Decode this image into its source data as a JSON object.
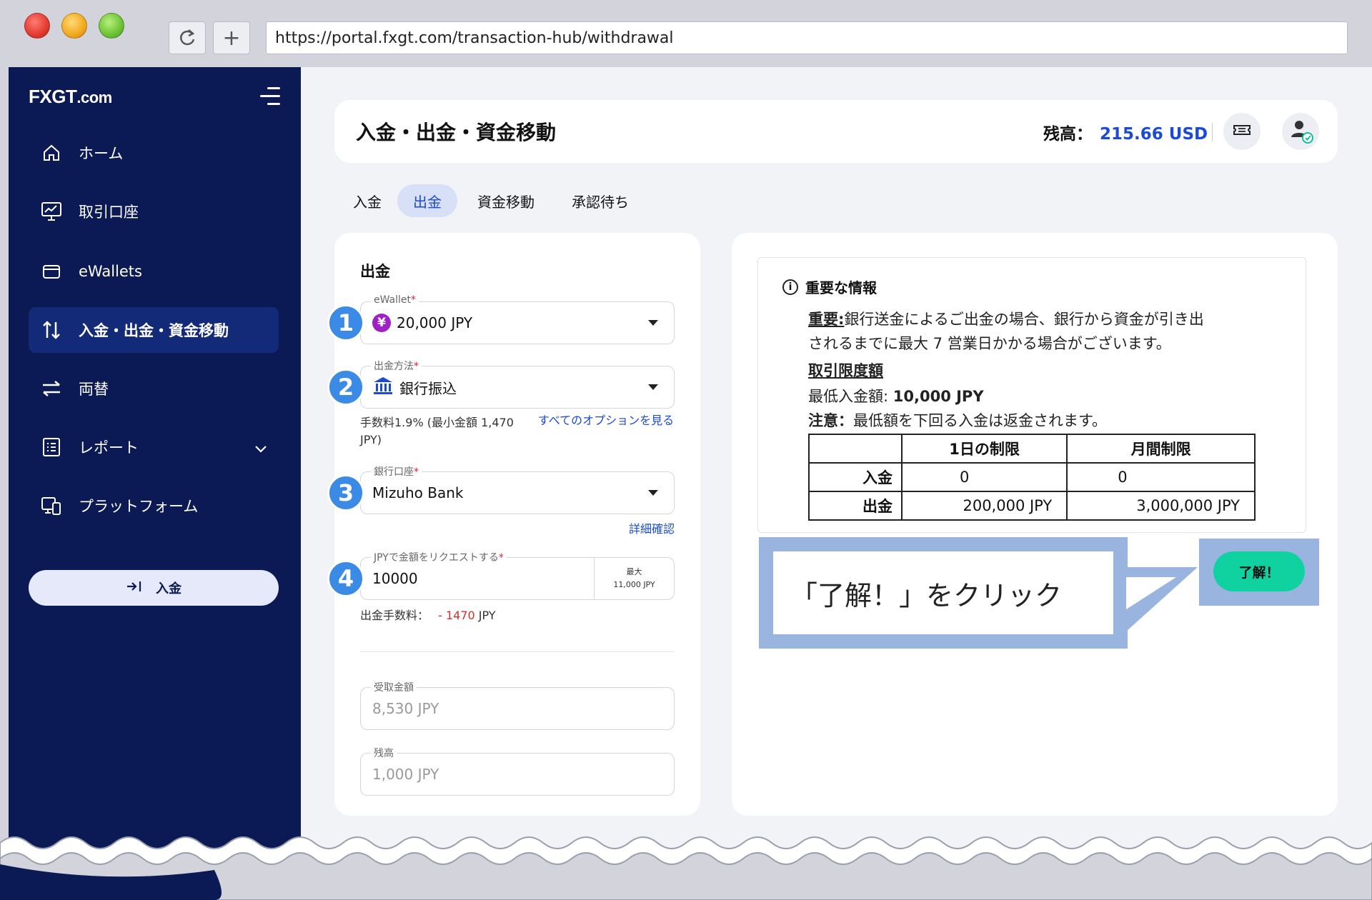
{
  "browser": {
    "url": "https://portal.fxgt.com/transaction-hub/withdrawal"
  },
  "sidebar": {
    "logo_main": "FXGT",
    "logo_suffix": ".com",
    "items": [
      {
        "label": "ホーム",
        "icon": "home-icon"
      },
      {
        "label": "取引口座",
        "icon": "chart-monitor-icon"
      },
      {
        "label": "eWallets",
        "icon": "wallet-icon"
      },
      {
        "label": "入金・出金・資金移動",
        "icon": "transfer-arrows-icon"
      },
      {
        "label": "両替",
        "icon": "exchange-icon"
      },
      {
        "label": "レポート",
        "icon": "report-list-icon"
      },
      {
        "label": "プラットフォーム",
        "icon": "devices-icon"
      }
    ],
    "deposit_button": "入金"
  },
  "header": {
    "title": "入金・出金・資金移動",
    "balance_label": "残高：",
    "balance_value": "215.66 USD"
  },
  "tabs": [
    "入金",
    "出金",
    "資金移動",
    "承認待ち"
  ],
  "form": {
    "title": "出金",
    "ewallet": {
      "label": "eWallet",
      "value": "20,000 JPY"
    },
    "method": {
      "label": "出金方法",
      "value": "銀行振込"
    },
    "fee_note": "手数料1.9% (最小金額 1,470 JPY)",
    "options_link": "すべてのオプションを見る",
    "bank": {
      "label": "銀行口座",
      "value": "Mizuho Bank"
    },
    "details_link": "詳細確認",
    "amount": {
      "label": "JPYで金額をリクエストする",
      "value": "10000",
      "max_label": "最大",
      "max_value": "11,000 JPY"
    },
    "withdraw_fee_label": "出金手数料：",
    "withdraw_fee_value": "- 1470",
    "withdraw_fee_unit": "JPY",
    "received": {
      "label": "受取金額",
      "placeholder": "8,530 JPY"
    },
    "remaining": {
      "label": "残高",
      "placeholder": "1,000 JPY"
    },
    "badges": [
      "1",
      "2",
      "3",
      "4"
    ]
  },
  "info": {
    "heading": "重要な情報",
    "important_label": "重要:",
    "important_text_1": "銀行送金によるご出金の場合、銀行から資金が引き出",
    "important_text_2": "されるまでに最大 7 営業日かかる場合がございます。",
    "limits_heading": "取引限度額",
    "min_label": "最低入金額: ",
    "min_value": "10,000 JPY",
    "note_label": "注意：",
    "note_text": "最低額を下回る入金は返金されます。",
    "table": {
      "headers": [
        "",
        "1日の制限",
        "月間制限"
      ],
      "rows": [
        [
          "入金",
          "0",
          "0"
        ],
        [
          "出金",
          "200,000 JPY",
          "3,000,000 JPY"
        ]
      ]
    }
  },
  "callout": {
    "text": "「了解！」をクリック",
    "ok_button": "了解！"
  }
}
